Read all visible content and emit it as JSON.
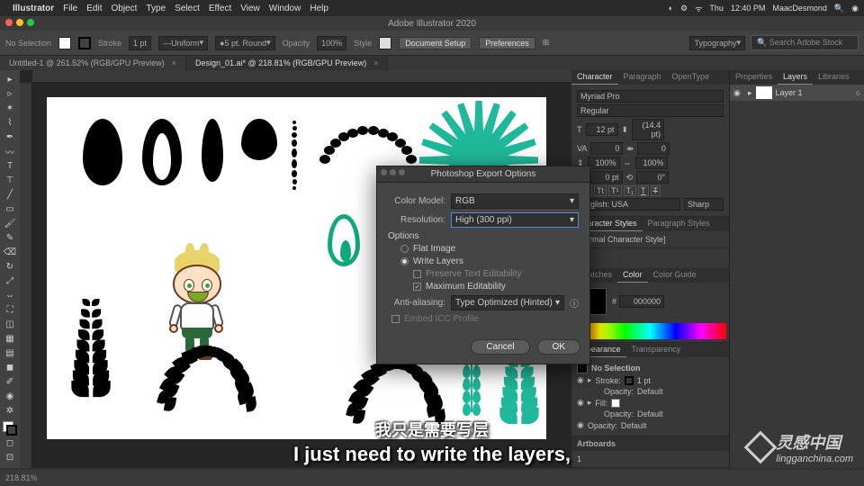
{
  "menubar": {
    "app": "Illustrator",
    "items": [
      "File",
      "Edit",
      "Object",
      "Type",
      "Select",
      "Effect",
      "View",
      "Window",
      "Help"
    ],
    "right": {
      "day": "Thu",
      "time": "12:40 PM",
      "user": "MaacDesmond"
    }
  },
  "titlebar": {
    "title": "Adobe Illustrator 2020"
  },
  "controlbar": {
    "noselection": "No Selection",
    "stroke_label": "Stroke",
    "stroke_val": "1 pt",
    "uniform": "Uniform",
    "brush": "5 pt. Round",
    "opacity_label": "Opacity",
    "opacity_val": "100%",
    "style_label": "Style",
    "docsetup": "Document Setup",
    "prefs": "Preferences",
    "workspace": "Typography",
    "search_placeholder": "Search Adobe Stock"
  },
  "tabs": [
    {
      "label": "Untitled-1 @ 261.52% (RGB/GPU Preview)"
    },
    {
      "label": "Design_01.ai* @ 218.81% (RGB/GPU Preview)",
      "active": true
    }
  ],
  "char": {
    "title_tabs": [
      "Character",
      "Paragraph",
      "OpenType"
    ],
    "font": "Myriad Pro",
    "style": "Regular",
    "size": "12 pt",
    "leading": "(14.4 pt)",
    "tracking": "0",
    "kerning": "0",
    "vscale": "100%",
    "hscale": "100%",
    "baseline": "0 pt",
    "rotation": "0°",
    "lang": "English: USA",
    "aa": "Sharp",
    "styles_tabs": [
      "Character Styles",
      "Paragraph Styles"
    ],
    "style_item": "[Normal Character Style]"
  },
  "color": {
    "tabs": [
      "Swatches",
      "Color",
      "Color Guide"
    ],
    "hex_label": "#",
    "hex": "000000"
  },
  "appearance": {
    "tabs": [
      "Appearance",
      "Transparency"
    ],
    "nosel": "No Selection",
    "stroke": "Stroke:",
    "stroke_val": "1 pt",
    "opacity": "Opacity:",
    "opacity_val": "Default",
    "fill": "Fill:",
    "opacity2": "Opacity:",
    "opacity2_val": "Default",
    "opacity3": "Opacity:",
    "opacity3_val": "Default"
  },
  "artboards": {
    "tab": "Artboards",
    "item": "1"
  },
  "right_panel": {
    "tabs": [
      "Properties",
      "Layers",
      "Libraries"
    ],
    "layer": "Layer 1"
  },
  "dialog": {
    "title": "Photoshop Export Options",
    "colormodel_label": "Color Model:",
    "colormodel": "RGB",
    "resolution_label": "Resolution:",
    "resolution": "High (300 ppi)",
    "options": "Options",
    "flat": "Flat Image",
    "write": "Write Layers",
    "preserve": "Preserve Text Editability",
    "max": "Maximum Editability",
    "aa_label": "Anti-aliasing:",
    "aa": "Type Optimized (Hinted)",
    "icc": "Embed ICC Profile",
    "cancel": "Cancel",
    "ok": "OK"
  },
  "subtitle": {
    "cn": "我只是需要写层",
    "en": "I just need to write the layers,"
  },
  "watermark": {
    "cn": "灵感中国",
    "en": "lingganchina.com"
  },
  "status": {
    "zoom": "218.81%"
  }
}
